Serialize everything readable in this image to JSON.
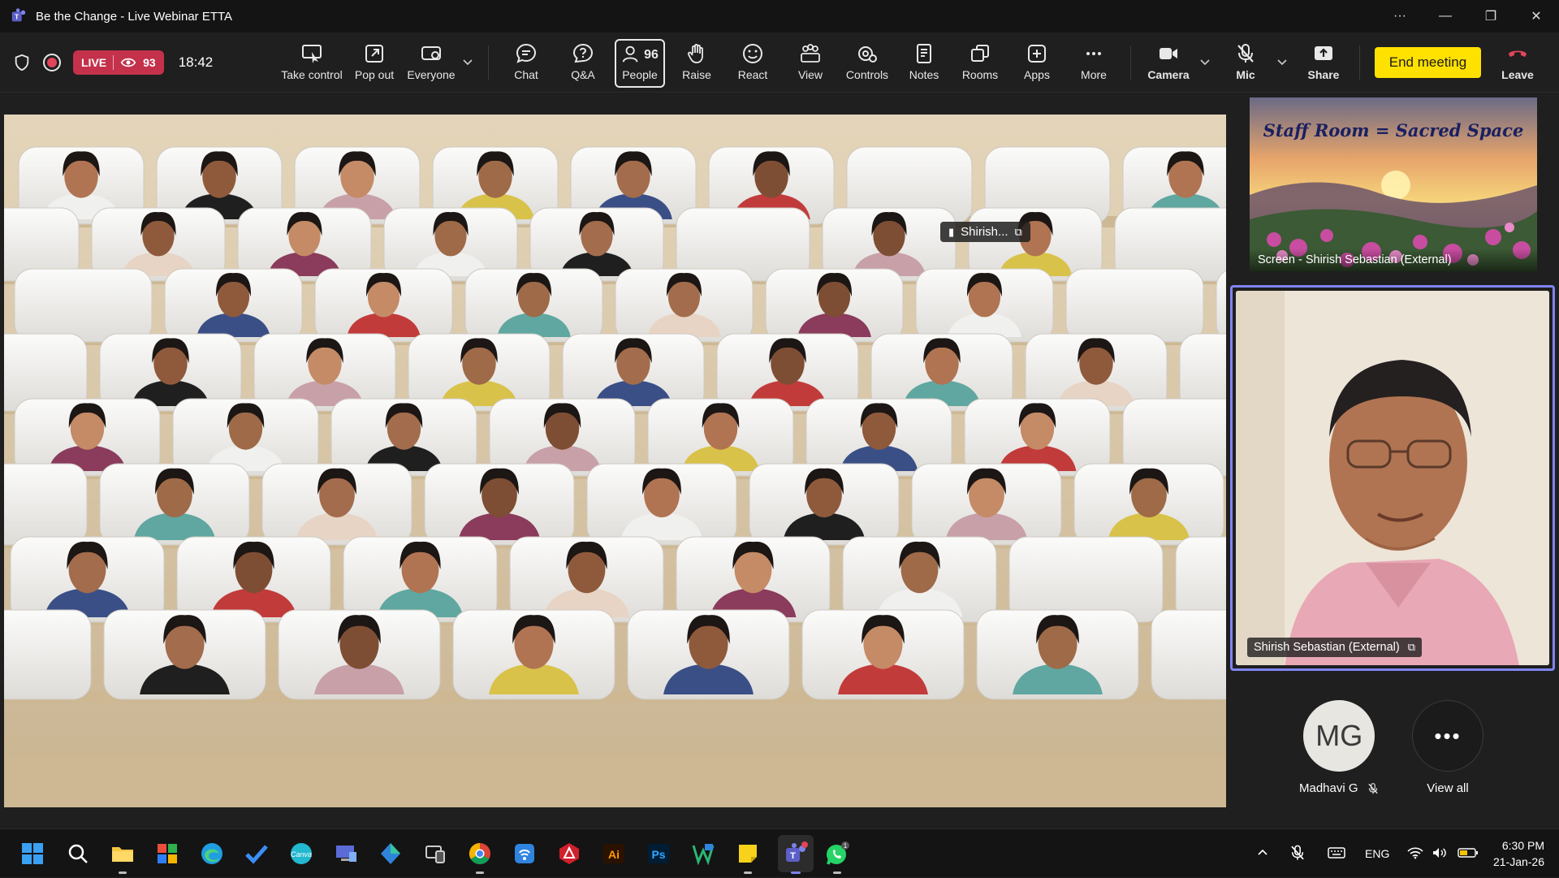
{
  "window": {
    "title": "Be the Change - Live Webinar ETTA"
  },
  "toolbar": {
    "live_label": "LIVE",
    "viewer_count": "93",
    "timer": "18:42",
    "people_count": "96",
    "buttons": {
      "take_control": "Take control",
      "pop_out": "Pop out",
      "everyone": "Everyone",
      "chat": "Chat",
      "qa": "Q&A",
      "people": "People",
      "raise": "Raise",
      "react": "React",
      "view": "View",
      "controls": "Controls",
      "notes": "Notes",
      "rooms": "Rooms",
      "apps": "Apps",
      "more": "More",
      "camera": "Camera",
      "mic": "Mic",
      "share": "Share",
      "leave": "Leave"
    },
    "end_meeting": "End meeting"
  },
  "stage": {
    "presenter_tag": "Shirish..."
  },
  "share_tile": {
    "slide_title": "Staff Room = Sacred Space",
    "label": "Screen - Shirish Sebastian (External)"
  },
  "speaker_tile": {
    "label": "Shirish Sebastian (External)"
  },
  "roster": [
    {
      "initials": "MG",
      "name": "Madhavi G"
    },
    {
      "name": "View all"
    }
  ],
  "tray": {
    "language": "ENG",
    "time": "6:30 PM",
    "date": "21-Jan-26",
    "whatsapp_badge": "1"
  },
  "colors": {
    "live": "#c4314b",
    "end_meeting": "#ffe100",
    "speaker_border": "#7f85f5",
    "leave_icon": "#e0455a"
  }
}
